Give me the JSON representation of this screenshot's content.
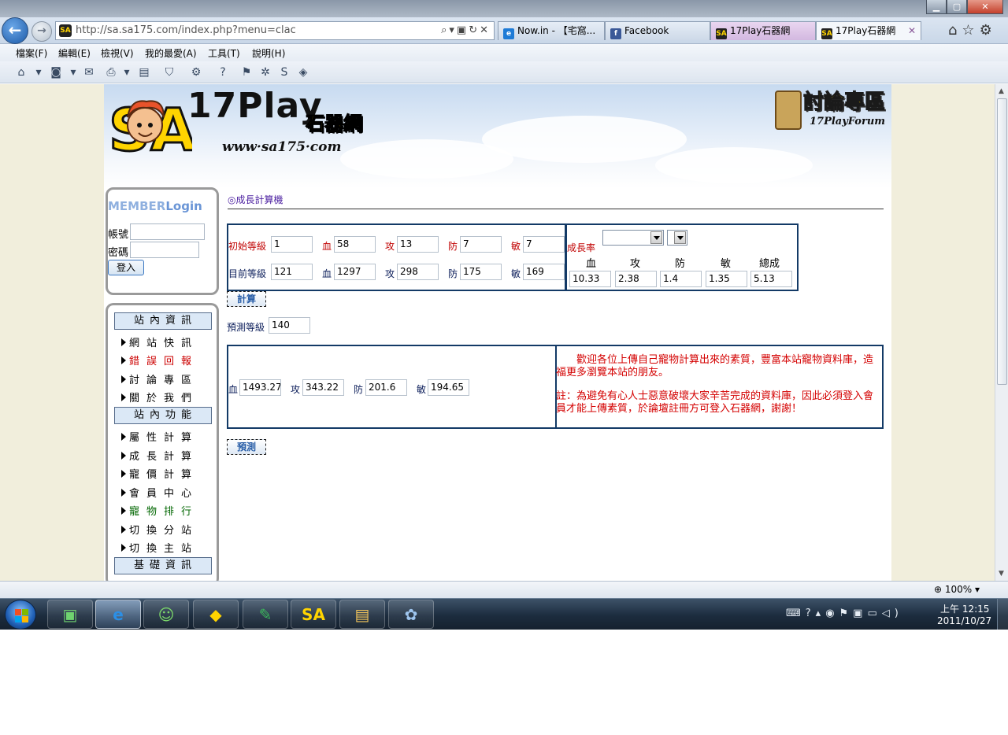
{
  "browser": {
    "url": "http://sa.sa175.com/index.php?menu=clac",
    "tabs": [
      {
        "label": "Now.in - 【宅窩..."
      },
      {
        "label": "Facebook"
      },
      {
        "label": "17Play石器網"
      },
      {
        "label": "17Play石器網"
      }
    ],
    "menu": [
      "檔案(F)",
      "編輯(E)",
      "檢視(V)",
      "我的最愛(A)",
      "工具(T)",
      "說明(H)"
    ],
    "zoom": "100%"
  },
  "header": {
    "logo_text": "17Play",
    "logo_cn": "石器網",
    "logo_url": "www·sa175·com",
    "forum_title": "討論專區",
    "forum_sub": "17PlayForum"
  },
  "login": {
    "title_a": "MEMBER",
    "title_b": "Login",
    "account_label": "帳號",
    "password_label": "密碼",
    "button": "登入"
  },
  "sidebar": {
    "section1": "站內資訊",
    "items1": [
      {
        "label": "網站快訊",
        "color": "#000000"
      },
      {
        "label": "錯誤回報",
        "color": "#cc0000"
      },
      {
        "label": "討論專區",
        "color": "#000000"
      },
      {
        "label": "關於我們",
        "color": "#000000"
      }
    ],
    "section2": "站內功能",
    "items2": [
      {
        "label": "屬性計算",
        "color": "#000000"
      },
      {
        "label": "成長計算",
        "color": "#000000"
      },
      {
        "label": "寵價計算",
        "color": "#000000"
      },
      {
        "label": "會員中心",
        "color": "#000000"
      },
      {
        "label": "寵物排行",
        "color": "#006600"
      },
      {
        "label": "切換分站",
        "color": "#000000"
      },
      {
        "label": "切換主站",
        "color": "#000000"
      }
    ],
    "section3": "基礎資訊"
  },
  "calc": {
    "title": "◎成長計算機",
    "start_level_label": "初始等級",
    "start": {
      "level": "1",
      "hp": "58",
      "atk": "13",
      "def": "7",
      "agi": "7"
    },
    "current_level_label": "目前等級",
    "current": {
      "level": "121",
      "hp": "1297",
      "atk": "298",
      "def": "175",
      "agi": "169"
    },
    "hp_label": "血",
    "atk_label": "攻",
    "def_label": "防",
    "agi_label": "敏",
    "growth_label": "成長率",
    "total_label": "總成",
    "growth": {
      "hp": "10.33",
      "atk": "2.38",
      "def": "1.4",
      "agi": "1.35",
      "total": "5.13"
    },
    "calc_button": "計算",
    "predict_level_label": "預測等級",
    "predict_level": "140",
    "result": {
      "hp": "1493.27",
      "atk": "343.22",
      "def": "201.6",
      "agi": "194.65"
    },
    "predict_button": "預測",
    "notice1": "歡迎各位上傳自己寵物計算出來的素質，豐富本站寵物資料庫，造福更多瀏覽本站的朋友。",
    "notice2": "註：為避免有心人士惡意破壞大家辛苦完成的資料庫，因此必須登入會員才能上傳素質，於論壇註冊方可登入石器網，謝謝！"
  },
  "taskbar": {
    "time": "上午 12:15",
    "date": "2011/10/27"
  }
}
